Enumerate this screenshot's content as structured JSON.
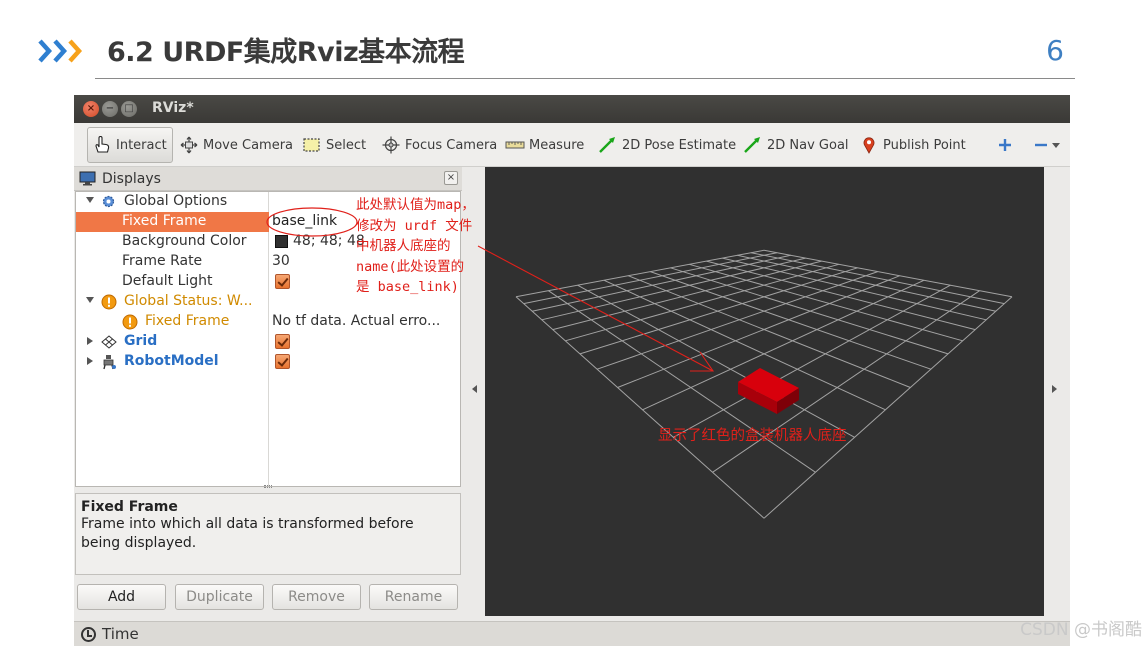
{
  "slide": {
    "title": "6.2 URDF集成Rviz基本流程",
    "page_number": "6",
    "accent": "#2f7fd0",
    "accent2": "#f7a21b"
  },
  "window": {
    "title": "RViz*",
    "controls": {
      "close": "×",
      "minimize": "−",
      "maximize": "□"
    }
  },
  "toolbar": {
    "interact": "Interact",
    "move_camera": "Move Camera",
    "select": "Select",
    "focus_camera": "Focus Camera",
    "measure": "Measure",
    "pose_estimate": "2D Pose Estimate",
    "nav_goal": "2D Nav Goal",
    "publish_point": "Publish Point"
  },
  "displays": {
    "title": "Displays",
    "close": "×",
    "rows": {
      "global_options": {
        "label": "Global Options"
      },
      "fixed_frame": {
        "label": "Fixed Frame",
        "value": "base_link"
      },
      "background_color": {
        "label": "Background Color",
        "value": "48; 48; 48",
        "swatch": "#303030"
      },
      "frame_rate": {
        "label": "Frame Rate",
        "value": "30"
      },
      "default_light": {
        "label": "Default Light",
        "checked": true
      },
      "global_status": {
        "label": "Global Status: W..."
      },
      "status_fixed_frame": {
        "label": "Fixed Frame",
        "value": "No tf data.  Actual erro..."
      },
      "grid": {
        "label": "Grid",
        "checked": true
      },
      "robot_model": {
        "label": "RobotModel",
        "checked": true
      }
    },
    "description": {
      "title": "Fixed Frame",
      "text": "Frame into which all data is transformed before being displayed."
    },
    "buttons": {
      "add": "Add",
      "duplicate": "Duplicate",
      "remove": "Remove",
      "rename": "Rename"
    }
  },
  "time_panel": {
    "label": "Time"
  },
  "viewport": {
    "background": "#303030",
    "grid_color": "#a0a0a0",
    "robot_color": "#c8000c"
  },
  "annotations": {
    "note": "此处默认值为map，\n修改为 urdf 文件\n中机器人底座的\nname(此处设置的\n是 base_link)",
    "caption": "显示了红色的盒装机器人底座",
    "color": "#e0201a"
  },
  "watermark": "CSDN @书阁酷"
}
